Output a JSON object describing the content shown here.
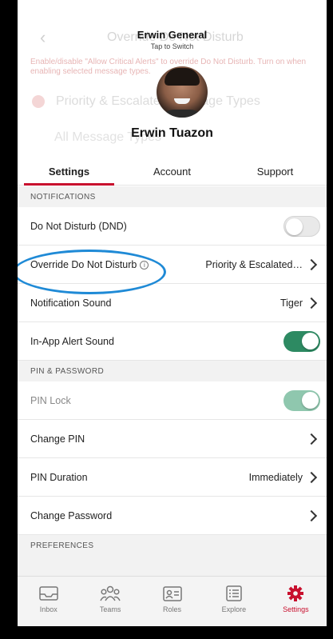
{
  "background_page": {
    "back_glyph": "‹",
    "title": "Override Do Not Disturb",
    "red_note": "Enable/disable \"Allow Critical Alerts\" to override Do Not Disturb. Turn on when enabling selected message types.",
    "option_row1": "Priority & Escalated Message Types",
    "option_row2": "All Message Types"
  },
  "account": {
    "name": "Erwin General",
    "subtitle": "Tap to Switch"
  },
  "profile": {
    "name": "Erwin Tuazon"
  },
  "tabs": [
    {
      "label": "Settings",
      "active": true
    },
    {
      "label": "Account",
      "active": false
    },
    {
      "label": "Support",
      "active": false
    }
  ],
  "sections": {
    "notifications": "NOTIFICATIONS",
    "pin_password": "PIN & PASSWORD",
    "preferences": "PREFERENCES"
  },
  "rows": {
    "dnd": {
      "label": "Do Not Disturb (DND)",
      "toggle": "off"
    },
    "override_dnd": {
      "label": "Override Do Not Disturb",
      "info_glyph": "i",
      "value": "Priority & Escalated…"
    },
    "notification_sound": {
      "label": "Notification Sound",
      "value": "Tiger"
    },
    "in_app_alert": {
      "label": "In-App Alert Sound",
      "toggle": "on"
    },
    "pin_lock": {
      "label": "PIN Lock",
      "toggle": "on"
    },
    "change_pin": {
      "label": "Change PIN"
    },
    "pin_duration": {
      "label": "PIN Duration",
      "value": "Immediately"
    },
    "change_password": {
      "label": "Change Password"
    }
  },
  "tabbar": [
    {
      "label": "Inbox",
      "icon": "inbox-icon",
      "active": false
    },
    {
      "label": "Teams",
      "icon": "teams-icon",
      "active": false
    },
    {
      "label": "Roles",
      "icon": "roles-icon",
      "active": false
    },
    {
      "label": "Explore",
      "icon": "explore-icon",
      "active": false
    },
    {
      "label": "Settings",
      "icon": "settings-gear-icon",
      "active": true
    }
  ],
  "colors": {
    "accent_red": "#c8102e",
    "toggle_green": "#2d8a62",
    "highlight_blue": "#1f8ad6"
  }
}
